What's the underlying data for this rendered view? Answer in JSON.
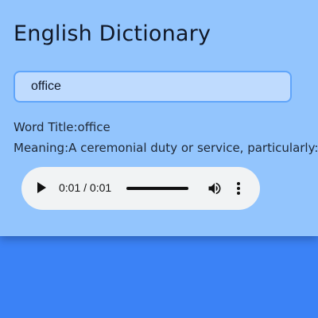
{
  "app": {
    "title": "English Dictionary"
  },
  "search": {
    "value": "office"
  },
  "result": {
    "word_title": "Word Title:office",
    "meaning": "Meaning:A ceremonial duty or service, particularly:"
  },
  "audio": {
    "time": "0:01 / 0:01",
    "progress": 1.0,
    "icons": {
      "play": "play-icon",
      "volume": "volume-icon",
      "more": "more-vert-icon"
    }
  },
  "colors": {
    "background": "#3b82f6",
    "card": "#93c5fd",
    "input_bg": "#bfdbfe",
    "input_border": "#60a5fa",
    "player_bg": "#f1f3f4"
  }
}
